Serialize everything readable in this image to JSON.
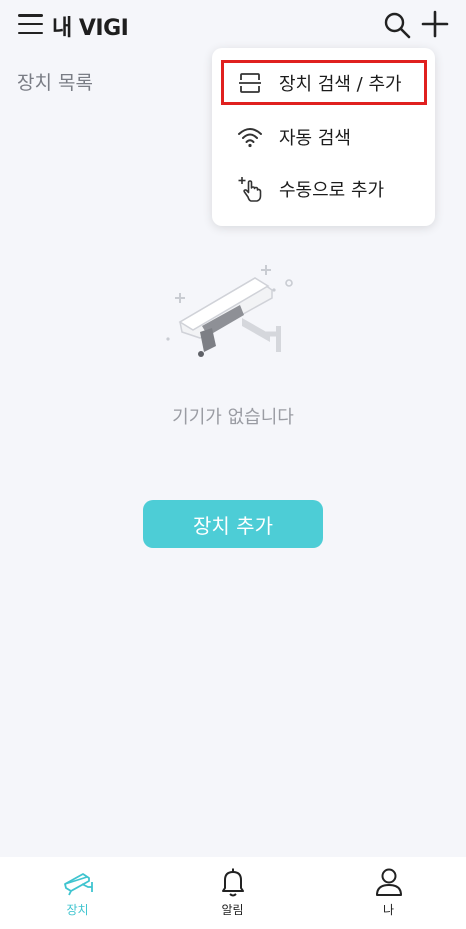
{
  "header": {
    "title": "내 VIGI",
    "menu_icon": "menu-icon",
    "search_icon": "search-icon",
    "add_icon": "plus-icon"
  },
  "section": {
    "label": "장치 목록"
  },
  "dropdown": {
    "items": [
      {
        "label": "장치 검색 / 추가",
        "icon": "scan-icon",
        "highlighted": true
      },
      {
        "label": "자동 검색",
        "icon": "wifi-icon"
      },
      {
        "label": "수동으로 추가",
        "icon": "tap-add-icon"
      }
    ],
    "highlight_color": "#e0201f"
  },
  "empty_state": {
    "illustration": "camera-icon",
    "message": "기기가 없습니다",
    "button_label": "장치 추가"
  },
  "tabs": [
    {
      "label": "장치",
      "icon": "camera-icon",
      "active": true
    },
    {
      "label": "알림",
      "icon": "bell-icon",
      "active": false
    },
    {
      "label": "나",
      "icon": "user-icon",
      "active": false
    }
  ],
  "colors": {
    "accent": "#4dcdd6",
    "background": "#f5f6fa",
    "active_tab": "#3fc4cf"
  }
}
